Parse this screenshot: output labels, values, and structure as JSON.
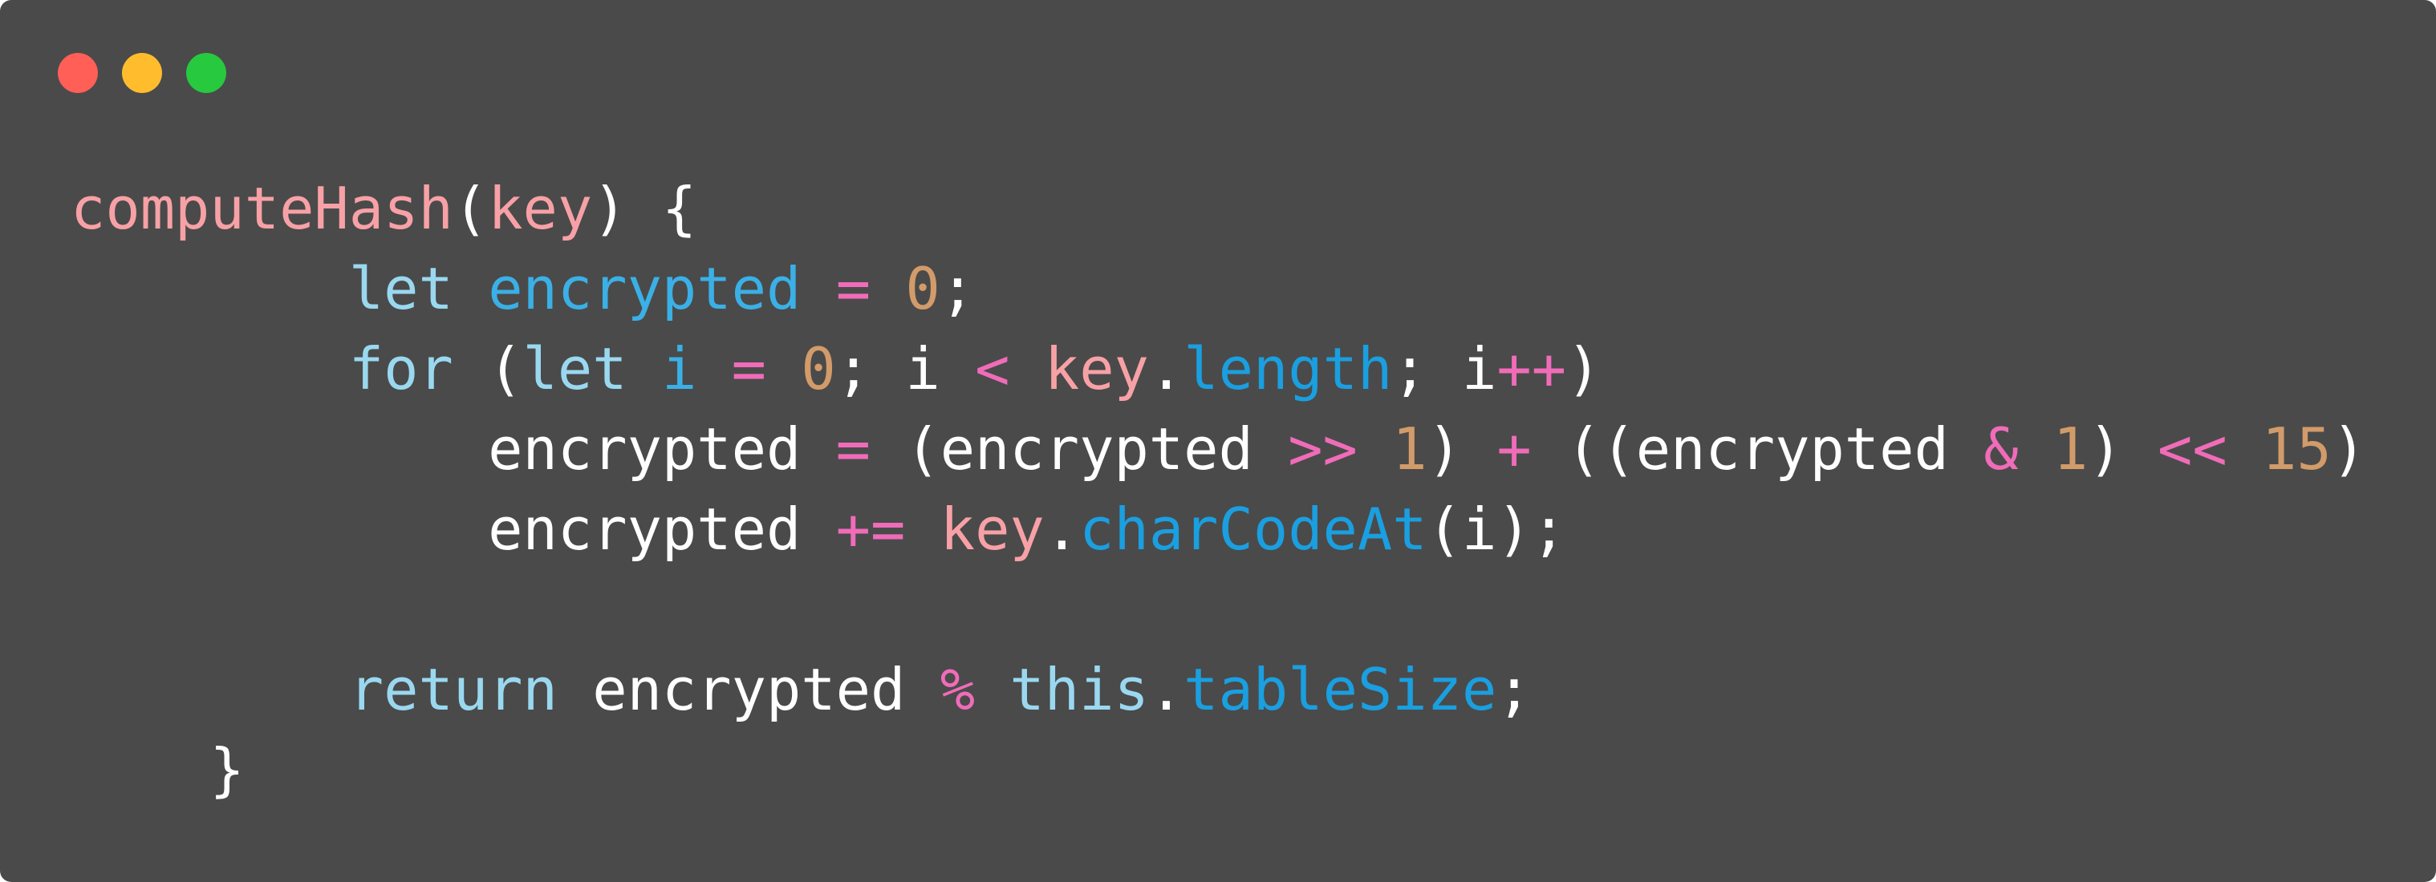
{
  "window": {
    "controls": [
      {
        "name": "close",
        "color": "#ff5f56"
      },
      {
        "name": "minimize",
        "color": "#ffbd2e"
      },
      {
        "name": "maximize",
        "color": "#27c93f"
      }
    ]
  },
  "colors": {
    "background": "#4a4a4a",
    "plain": "#ffffff",
    "function": "#f7a1a6",
    "keyword": "#9ad8f0",
    "variable": "#3ab0e6",
    "operator": "#f06cb9",
    "number": "#d29b6a",
    "property": "#1a9fe0"
  },
  "code": {
    "lines": [
      [
        {
          "t": "computeHash",
          "c": "function"
        },
        {
          "t": "(",
          "c": "plain"
        },
        {
          "t": "key",
          "c": "function"
        },
        {
          "t": ") {",
          "c": "plain"
        }
      ],
      [
        {
          "t": "        ",
          "c": "plain"
        },
        {
          "t": "let",
          "c": "keyword"
        },
        {
          "t": " ",
          "c": "plain"
        },
        {
          "t": "encrypted",
          "c": "variable"
        },
        {
          "t": " ",
          "c": "plain"
        },
        {
          "t": "=",
          "c": "operator"
        },
        {
          "t": " ",
          "c": "plain"
        },
        {
          "t": "0",
          "c": "number"
        },
        {
          "t": ";",
          "c": "plain"
        }
      ],
      [
        {
          "t": "        ",
          "c": "plain"
        },
        {
          "t": "for",
          "c": "keyword"
        },
        {
          "t": " (",
          "c": "plain"
        },
        {
          "t": "let",
          "c": "keyword"
        },
        {
          "t": " ",
          "c": "plain"
        },
        {
          "t": "i",
          "c": "variable"
        },
        {
          "t": " ",
          "c": "plain"
        },
        {
          "t": "=",
          "c": "operator"
        },
        {
          "t": " ",
          "c": "plain"
        },
        {
          "t": "0",
          "c": "number"
        },
        {
          "t": "; i ",
          "c": "plain"
        },
        {
          "t": "<",
          "c": "operator"
        },
        {
          "t": " ",
          "c": "plain"
        },
        {
          "t": "key",
          "c": "function"
        },
        {
          "t": ".",
          "c": "plain"
        },
        {
          "t": "length",
          "c": "property"
        },
        {
          "t": "; i",
          "c": "plain"
        },
        {
          "t": "++",
          "c": "operator"
        },
        {
          "t": ")",
          "c": "plain"
        }
      ],
      [
        {
          "t": "            encrypted ",
          "c": "plain"
        },
        {
          "t": "=",
          "c": "operator"
        },
        {
          "t": " (encrypted ",
          "c": "plain"
        },
        {
          "t": ">>",
          "c": "operator"
        },
        {
          "t": " ",
          "c": "plain"
        },
        {
          "t": "1",
          "c": "number"
        },
        {
          "t": ") ",
          "c": "plain"
        },
        {
          "t": "+",
          "c": "operator"
        },
        {
          "t": " ((encrypted ",
          "c": "plain"
        },
        {
          "t": "&",
          "c": "operator"
        },
        {
          "t": " ",
          "c": "plain"
        },
        {
          "t": "1",
          "c": "number"
        },
        {
          "t": ") ",
          "c": "plain"
        },
        {
          "t": "<<",
          "c": "operator"
        },
        {
          "t": " ",
          "c": "plain"
        },
        {
          "t": "15",
          "c": "number"
        },
        {
          "t": ")",
          "c": "plain"
        }
      ],
      [
        {
          "t": "            encrypted ",
          "c": "plain"
        },
        {
          "t": "+=",
          "c": "operator"
        },
        {
          "t": " ",
          "c": "plain"
        },
        {
          "t": "key",
          "c": "function"
        },
        {
          "t": ".",
          "c": "plain"
        },
        {
          "t": "charCodeAt",
          "c": "property"
        },
        {
          "t": "(i);",
          "c": "plain"
        }
      ],
      [],
      [
        {
          "t": "        ",
          "c": "plain"
        },
        {
          "t": "return",
          "c": "keyword"
        },
        {
          "t": " encrypted ",
          "c": "plain"
        },
        {
          "t": "%",
          "c": "operator"
        },
        {
          "t": " ",
          "c": "plain"
        },
        {
          "t": "this",
          "c": "keyword"
        },
        {
          "t": ".",
          "c": "plain"
        },
        {
          "t": "tableSize",
          "c": "property"
        },
        {
          "t": ";",
          "c": "plain"
        }
      ],
      [
        {
          "t": "    }",
          "c": "plain"
        }
      ]
    ]
  }
}
